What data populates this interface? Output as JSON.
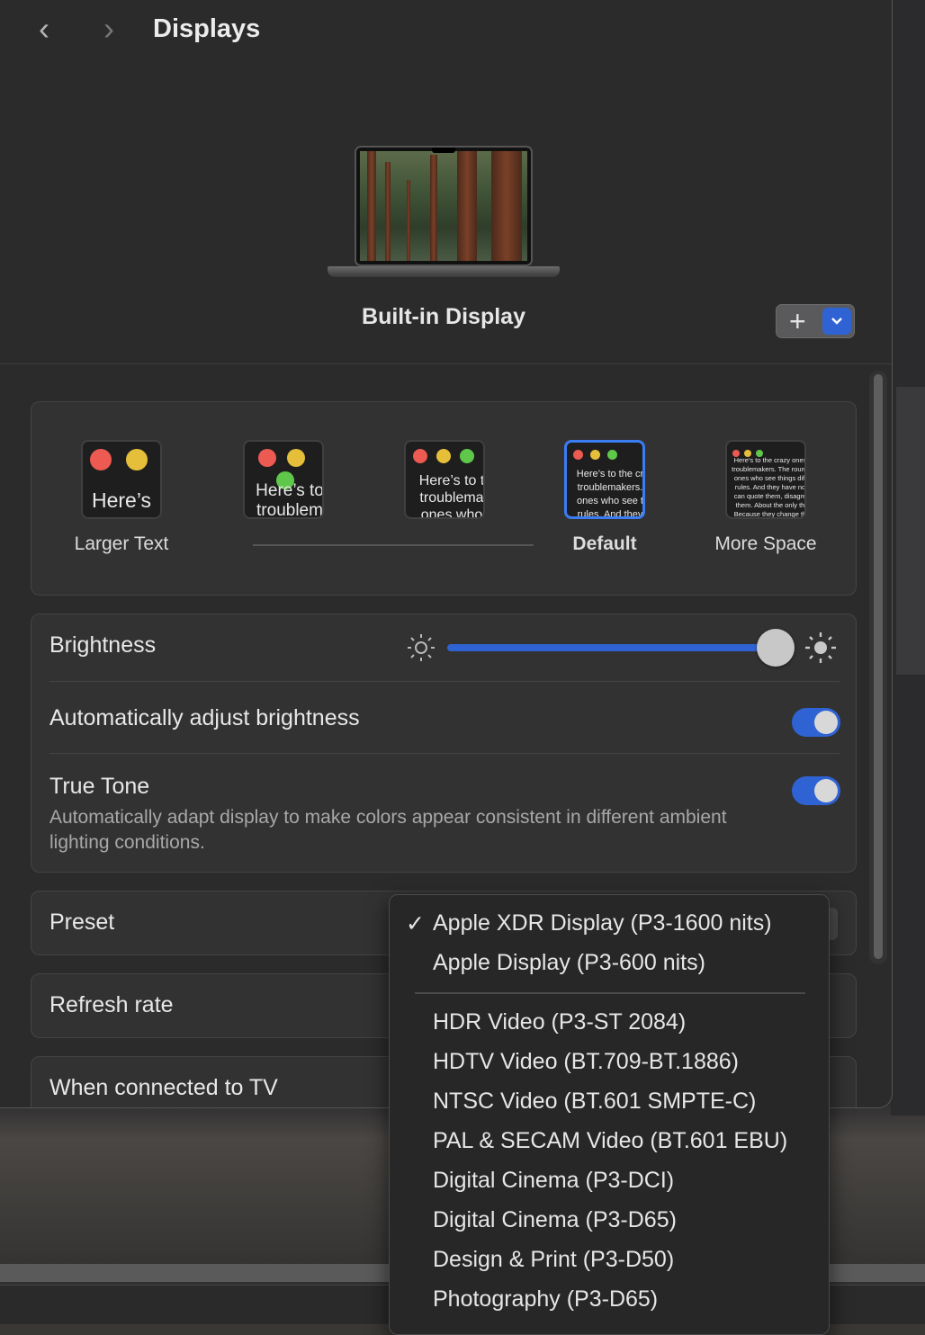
{
  "window": {
    "title": "Displays",
    "back_icon": "‹",
    "forward_icon": "›"
  },
  "display": {
    "name": "Built-in Display",
    "add_symbol": "+",
    "menu_symbol": "⌄"
  },
  "resolution": {
    "options": [
      {
        "label": "Larger Text",
        "preview": "Here’s"
      },
      {
        "label": "",
        "preview": "Here’s to troublem"
      },
      {
        "label": "",
        "preview": "Here’s to t troublema ones who"
      },
      {
        "label": "Default",
        "preview": "Here’s to the cr troublemakers. ones who see t rules. And they"
      },
      {
        "label": "More Space",
        "preview": "Here’s to the crazy ones troublemakers. The round ones who see things diff rules. And they have no can quote them, disagre them. About the only th Because they change th"
      }
    ],
    "selected": "Default"
  },
  "brightness": {
    "label": "Brightness",
    "value_percent": 95,
    "auto_label": "Automatically adjust brightness",
    "auto_on": true
  },
  "true_tone": {
    "label": "True Tone",
    "description": "Automatically adapt display to make colors appear consistent in different ambient lighting conditions.",
    "on": true
  },
  "preset": {
    "label": "Preset",
    "selected": "Apple XDR Display (P3-1600 nits)",
    "options_group1": [
      "Apple XDR Display (P3-1600 nits)",
      "Apple Display (P3-600 nits)"
    ],
    "options_group2": [
      "HDR Video (P3-ST 2084)",
      "HDTV Video (BT.709-BT.1886)",
      "NTSC Video (BT.601 SMPTE-C)",
      "PAL & SECAM Video (BT.601 EBU)",
      "Digital Cinema (P3-DCI)",
      "Digital Cinema (P3-D65)",
      "Design & Print (P3-D50)",
      "Photography (P3-D65)"
    ]
  },
  "refresh_rate": {
    "label": "Refresh rate"
  },
  "tv": {
    "label": "When connected to TV"
  },
  "colors": {
    "accent": "#2f63d3",
    "dot_red": "#ec5a52",
    "dot_yellow": "#e6bf3a",
    "dot_green": "#5fc84a"
  }
}
